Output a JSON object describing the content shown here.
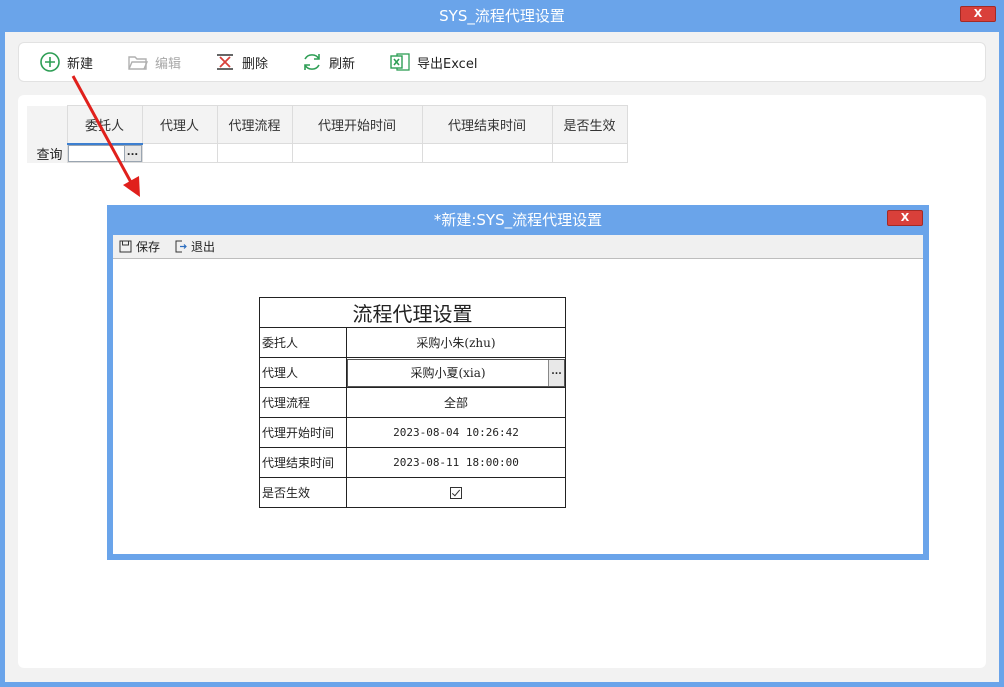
{
  "window": {
    "title": "SYS_流程代理设置",
    "close_label": "X"
  },
  "toolbar": {
    "new_label": "新建",
    "edit_label": "编辑",
    "delete_label": "删除",
    "refresh_label": "刷新",
    "export_label": "导出Excel"
  },
  "grid": {
    "columns": [
      "委托人",
      "代理人",
      "代理流程",
      "代理开始时间",
      "代理结束时间",
      "是否生效"
    ],
    "query_row_label": "查询",
    "ellipsis": "..."
  },
  "dialog": {
    "title": "*新建:SYS_流程代理设置",
    "close_label": "X",
    "toolbar": {
      "save_label": "保存",
      "exit_label": "退出"
    },
    "form": {
      "title": "流程代理设置",
      "rows": [
        {
          "label": "委托人",
          "value": "采购小朱(zhu)"
        },
        {
          "label": "代理人",
          "value": "采购小夏(xia)"
        },
        {
          "label": "代理流程",
          "value": "全部"
        },
        {
          "label": "代理开始时间",
          "value": "2023-08-04 10:26:42"
        },
        {
          "label": "代理结束时间",
          "value": "2023-08-11 18:00:00"
        },
        {
          "label": "是否生效",
          "checked": true
        }
      ],
      "ellipsis": "..."
    }
  },
  "colors": {
    "title_bar": "#6aa4ea",
    "close_button": "#d9403a",
    "arrow": "#e0201c",
    "active_tab": "#3d7fd0"
  }
}
